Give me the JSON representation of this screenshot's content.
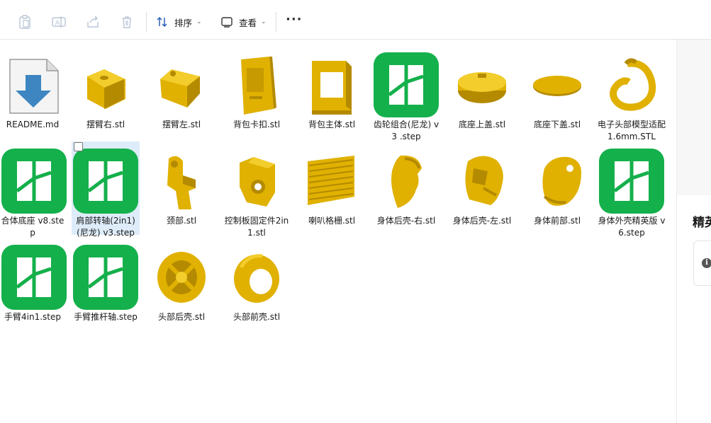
{
  "toolbar": {
    "sort_label": "排序",
    "view_label": "查看",
    "more_label": "···"
  },
  "files": [
    {
      "name": "README.md",
      "type": "md-doc",
      "selected": false
    },
    {
      "name": "摆臂右.stl",
      "type": "stl-block",
      "selected": false
    },
    {
      "name": "摆臂左.stl",
      "type": "stl-block2",
      "selected": false
    },
    {
      "name": "背包卡扣.stl",
      "type": "stl-plate",
      "selected": false
    },
    {
      "name": "背包主体.stl",
      "type": "stl-frame",
      "selected": false
    },
    {
      "name": "齿轮组合(尼龙) v3 .step",
      "type": "step",
      "selected": false
    },
    {
      "name": "底座上盖.stl",
      "type": "stl-cap",
      "selected": false
    },
    {
      "name": "底座下盖.stl",
      "type": "stl-disc",
      "selected": false
    },
    {
      "name": "电子头部模型适配1.6mm.STL",
      "type": "stl-ring-open",
      "selected": false
    },
    {
      "name": "合体底座 v8.step",
      "type": "step",
      "selected": false
    },
    {
      "name": "肩部转轴(2in1)(尼龙) v3.step",
      "type": "step",
      "selected": true
    },
    {
      "name": "颈部.stl",
      "type": "stl-neck",
      "selected": false
    },
    {
      "name": "控制板固定件2in1.stl",
      "type": "stl-bracket",
      "selected": false
    },
    {
      "name": "喇叭格栅.stl",
      "type": "stl-grille",
      "selected": false
    },
    {
      "name": "身体后壳-右.stl",
      "type": "stl-shell-r",
      "selected": false
    },
    {
      "name": "身体后壳-左.stl",
      "type": "stl-shell-l",
      "selected": false
    },
    {
      "name": "身体前部.stl",
      "type": "stl-front",
      "selected": false
    },
    {
      "name": "身体外壳精英版 v6.step",
      "type": "step",
      "selected": false
    },
    {
      "name": "手臂4in1.step",
      "type": "step",
      "selected": false
    },
    {
      "name": "手臂推杆轴.step",
      "type": "step",
      "selected": false
    },
    {
      "name": "头部后壳.stl",
      "type": "stl-headback",
      "selected": false
    },
    {
      "name": "头部前壳.stl",
      "type": "stl-ring",
      "selected": false
    }
  ],
  "details": {
    "title": "精英"
  },
  "colors": {
    "stl": "#e0b100",
    "stl_dark": "#b48a00",
    "stl_light": "#f2cd2c",
    "step_green": "#14b04b",
    "selection": "#deecf9"
  }
}
